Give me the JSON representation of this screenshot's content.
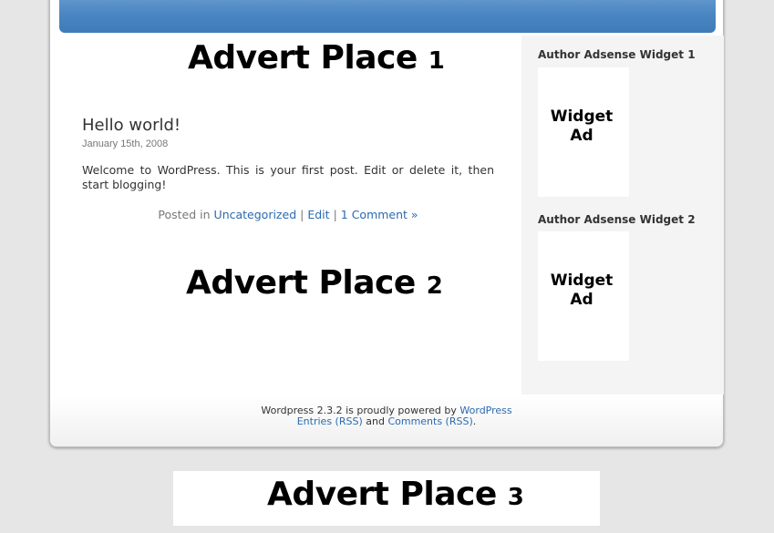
{
  "adverts": {
    "place1": {
      "label": "Advert Place",
      "num": "1"
    },
    "place2": {
      "label": "Advert Place",
      "num": "2"
    },
    "place3": {
      "label": "Advert Place",
      "num": "3"
    }
  },
  "post": {
    "title": "Hello world!",
    "date": "January 15th, 2008",
    "body": "Welcome to WordPress. This is your first post. Edit or delete it, then start blogging!",
    "meta_prefix": "Posted in",
    "category": "Uncategorized",
    "edit": "Edit",
    "comments": "1 Comment »"
  },
  "sidebar": {
    "widget1": {
      "title": "Author Adsense Widget 1",
      "ad_line1": "Widget",
      "ad_line2": "Ad"
    },
    "widget2": {
      "title": "Author Adsense Widget 2",
      "ad_line1": "Widget",
      "ad_line2": "Ad"
    }
  },
  "footer": {
    "powered_prefix": "Wordpress 2.3.2 is proudly powered by",
    "powered_link": "WordPress",
    "entries_rss": "Entries (RSS)",
    "and": "and",
    "comments_rss": "Comments (RSS)",
    "period": "."
  },
  "colors": {
    "header_blue": "#4a86c2",
    "link": "#2a6aaf",
    "sidebar_bg": "#f4f4f4",
    "page_bg": "#e6e6e6"
  }
}
